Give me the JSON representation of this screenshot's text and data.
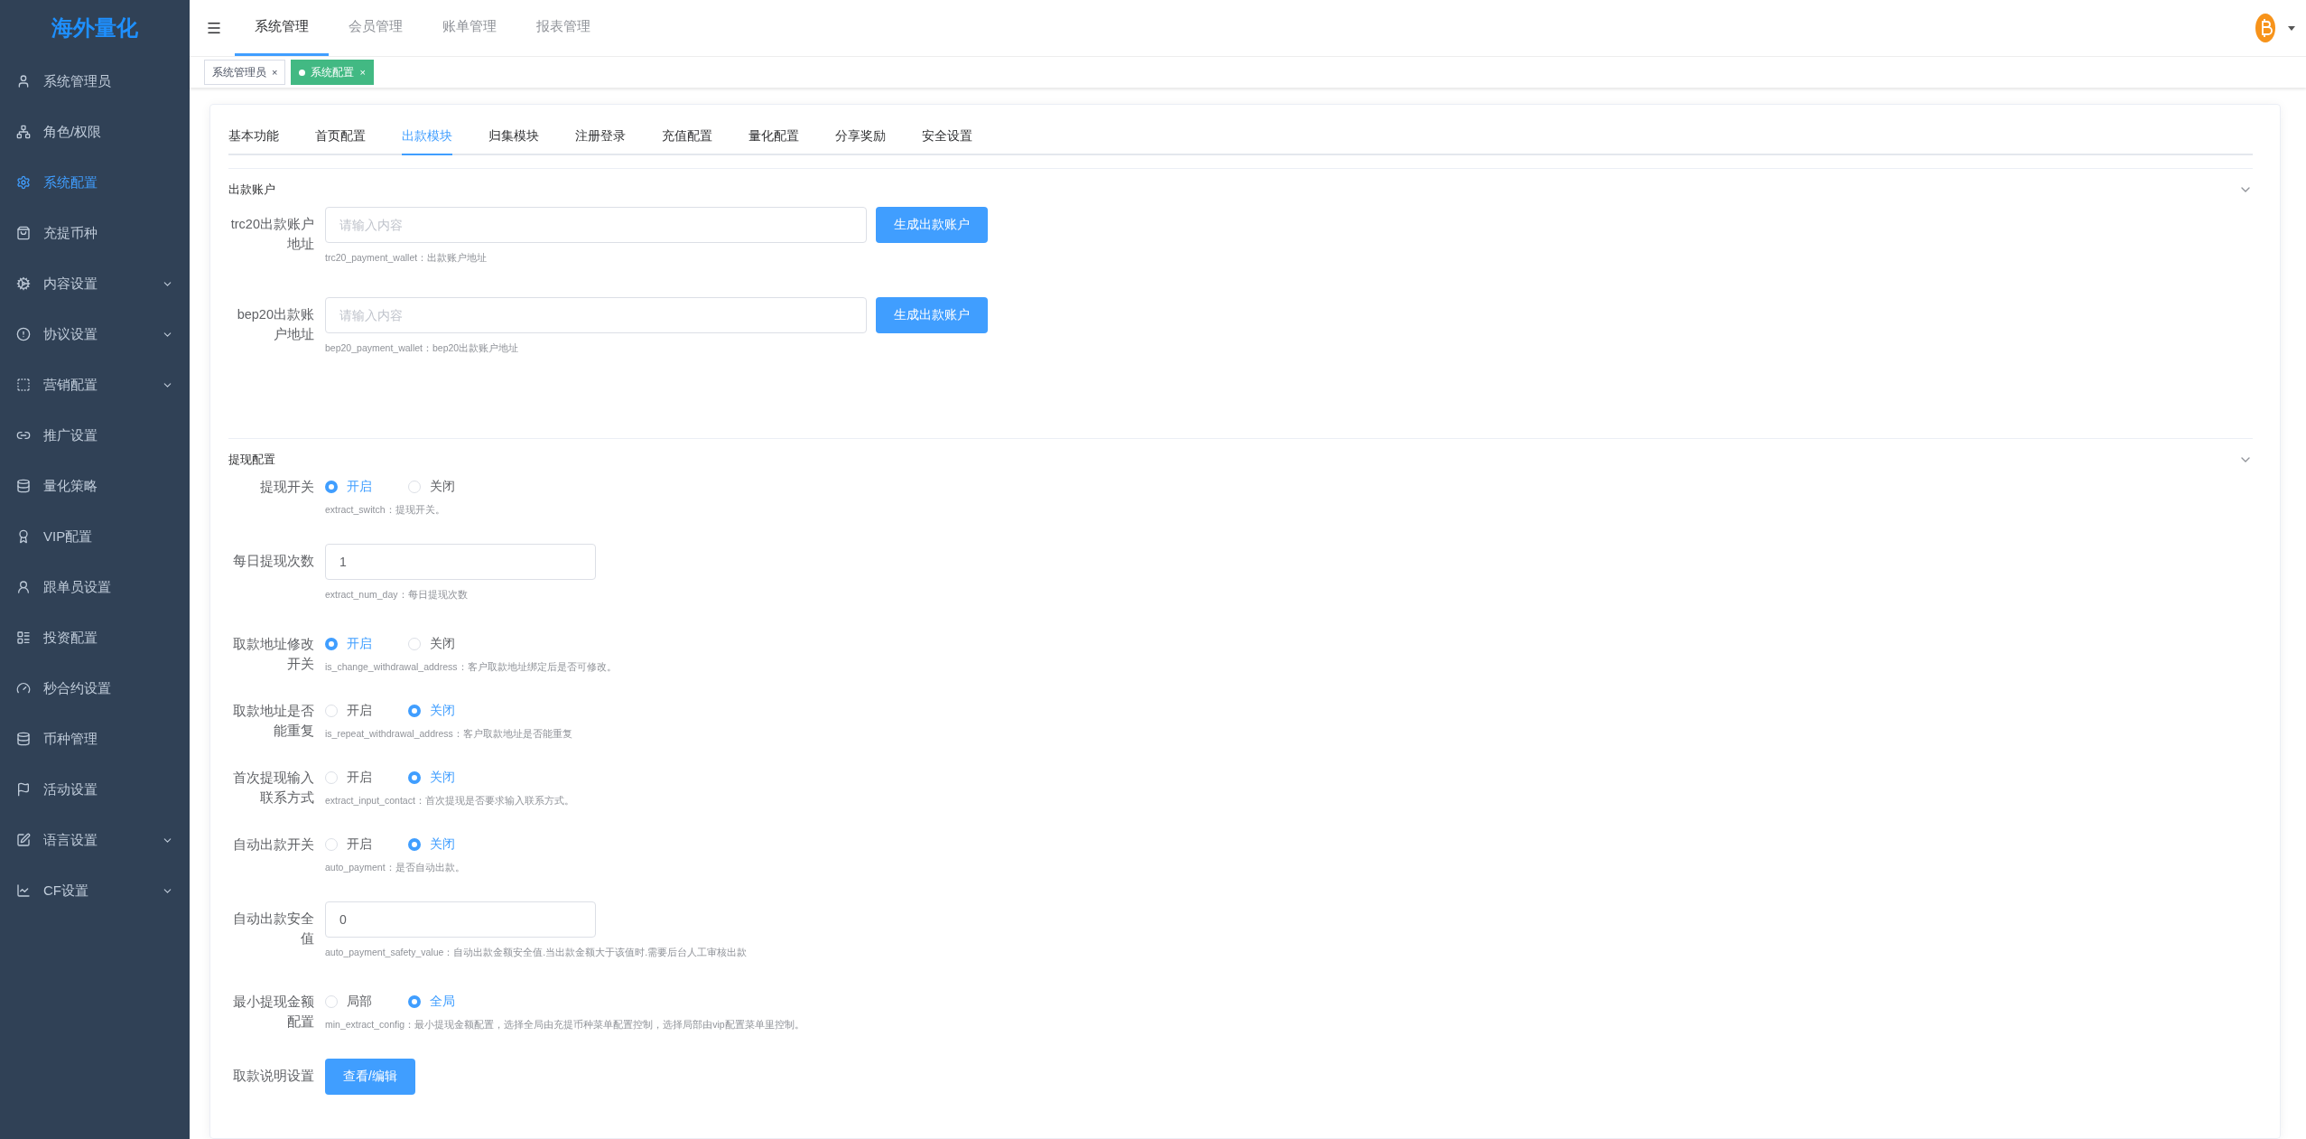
{
  "sidebar": {
    "logo": "海外量化",
    "items": [
      {
        "label": "系统管理员",
        "selected": false,
        "expandable": false
      },
      {
        "label": "角色/权限",
        "selected": false,
        "expandable": false
      },
      {
        "label": "系统配置",
        "selected": true,
        "expandable": false
      },
      {
        "label": "充提币种",
        "selected": false,
        "expandable": false
      },
      {
        "label": "内容设置",
        "selected": false,
        "expandable": true
      },
      {
        "label": "协议设置",
        "selected": false,
        "expandable": true
      },
      {
        "label": "营销配置",
        "selected": false,
        "expandable": true
      },
      {
        "label": "推广设置",
        "selected": false,
        "expandable": false
      },
      {
        "label": "量化策略",
        "selected": false,
        "expandable": false
      },
      {
        "label": "VIP配置",
        "selected": false,
        "expandable": false
      },
      {
        "label": "跟单员设置",
        "selected": false,
        "expandable": false
      },
      {
        "label": "投资配置",
        "selected": false,
        "expandable": false
      },
      {
        "label": "秒合约设置",
        "selected": false,
        "expandable": false
      },
      {
        "label": "币种管理",
        "selected": false,
        "expandable": false
      },
      {
        "label": "活动设置",
        "selected": false,
        "expandable": false
      },
      {
        "label": "语言设置",
        "selected": false,
        "expandable": true
      },
      {
        "label": "CF设置",
        "selected": false,
        "expandable": true
      }
    ]
  },
  "top_nav": [
    {
      "label": "系统管理",
      "selected": true
    },
    {
      "label": "会员管理",
      "selected": false
    },
    {
      "label": "账单管理",
      "selected": false
    },
    {
      "label": "报表管理",
      "selected": false
    }
  ],
  "tags": [
    {
      "label": "系统管理员",
      "close": "×",
      "selected": false
    },
    {
      "label": "系统配置",
      "close": "×",
      "selected": true
    }
  ],
  "tabs": [
    {
      "label": "基本功能",
      "selected": false
    },
    {
      "label": "首页配置",
      "selected": false
    },
    {
      "label": "出款模块",
      "selected": true
    },
    {
      "label": "归集模块",
      "selected": false
    },
    {
      "label": "注册登录",
      "selected": false
    },
    {
      "label": "充值配置",
      "selected": false
    },
    {
      "label": "量化配置",
      "selected": false
    },
    {
      "label": "分享奖励",
      "selected": false
    },
    {
      "label": "安全设置",
      "selected": false
    }
  ],
  "sections": [
    {
      "title": "出款账户",
      "rows": [
        {
          "kind": "address",
          "label": "trc20出款账户地址",
          "placeholder": "请输入内容",
          "button": "生成出款账户",
          "hint": "trc20_payment_wallet：出款账户地址"
        },
        {
          "kind": "address",
          "label": "bep20出款账户地址",
          "placeholder": "请输入内容",
          "button": "生成出款账户",
          "hint": "bep20_payment_wallet：bep20出款账户地址"
        }
      ]
    },
    {
      "title": "提现配置",
      "rows": [
        {
          "kind": "radio",
          "label": "提现开关",
          "options": [
            {
              "label": "开启",
              "selected": true
            },
            {
              "label": "关闭",
              "selected": false
            }
          ],
          "hint": "extract_switch：提现开关。"
        },
        {
          "kind": "input",
          "label": "每日提现次数",
          "value": "1",
          "hint": "extract_num_day：每日提现次数"
        },
        {
          "kind": "radio",
          "label": "取款地址修改开关",
          "options": [
            {
              "label": "开启",
              "selected": true
            },
            {
              "label": "关闭",
              "selected": false
            }
          ],
          "hint": "is_change_withdrawal_address：客户取款地址绑定后是否可修改。"
        },
        {
          "kind": "radio",
          "label": "取款地址是否能重复",
          "options": [
            {
              "label": "开启",
              "selected": false
            },
            {
              "label": "关闭",
              "selected": true
            }
          ],
          "hint": "is_repeat_withdrawal_address：客户取款地址是否能重复"
        },
        {
          "kind": "radio",
          "label": "首次提现输入联系方式",
          "options": [
            {
              "label": "开启",
              "selected": false
            },
            {
              "label": "关闭",
              "selected": true
            }
          ],
          "hint": "extract_input_contact：首次提现是否要求输入联系方式。"
        },
        {
          "kind": "radio",
          "label": "自动出款开关",
          "options": [
            {
              "label": "开启",
              "selected": false
            },
            {
              "label": "关闭",
              "selected": true
            }
          ],
          "hint": "auto_payment：是否自动出款。"
        },
        {
          "kind": "input",
          "label": "自动出款安全值",
          "value": "0",
          "hint": "auto_payment_safety_value：自动出款金额安全值.当出款金额大于该值时.需要后台人工审核出款"
        },
        {
          "kind": "radio",
          "label": "最小提现金额配置",
          "options": [
            {
              "label": "局部",
              "selected": false
            },
            {
              "label": "全局",
              "selected": true
            }
          ],
          "hint": "min_extract_config：最小提现金额配置，选择全局由充提币种菜单配置控制，选择局部由vip配置菜单里控制。"
        },
        {
          "kind": "button",
          "label": "取款说明设置",
          "button": "查看/编辑"
        }
      ]
    }
  ]
}
